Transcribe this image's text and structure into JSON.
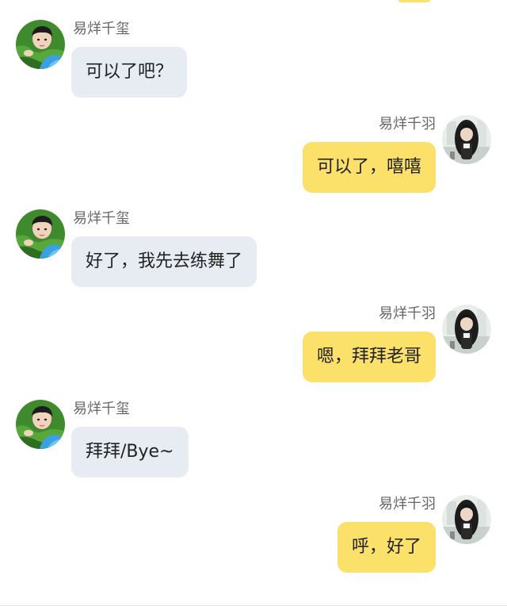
{
  "chat": {
    "messages": [
      {
        "side": "left",
        "sender": "易烊千玺",
        "text": "可以了吧？",
        "avatar_icon": "boy-lying-on-grass-avatar-icon"
      },
      {
        "side": "right",
        "sender": "易烊千羽",
        "text": "可以了，嘻嘻",
        "avatar_icon": "girl-in-white-room-avatar-icon"
      },
      {
        "side": "left",
        "sender": "易烊千玺",
        "text": "好了，我先去练舞了",
        "avatar_icon": "boy-lying-on-grass-avatar-icon"
      },
      {
        "side": "right",
        "sender": "易烊千羽",
        "text": "嗯，拜拜老哥",
        "avatar_icon": "girl-in-white-room-avatar-icon"
      },
      {
        "side": "left",
        "sender": "易烊千玺",
        "text": "拜拜/Bye~",
        "avatar_icon": "boy-lying-on-grass-avatar-icon"
      },
      {
        "side": "right",
        "sender": "易烊千羽",
        "text": "呼，好了",
        "avatar_icon": "girl-in-white-room-avatar-icon"
      }
    ]
  },
  "colors": {
    "left_bubble": "#e7ecf3",
    "right_bubble": "#fbe06a",
    "sender_name": "#666666",
    "message_text": "#222222"
  }
}
